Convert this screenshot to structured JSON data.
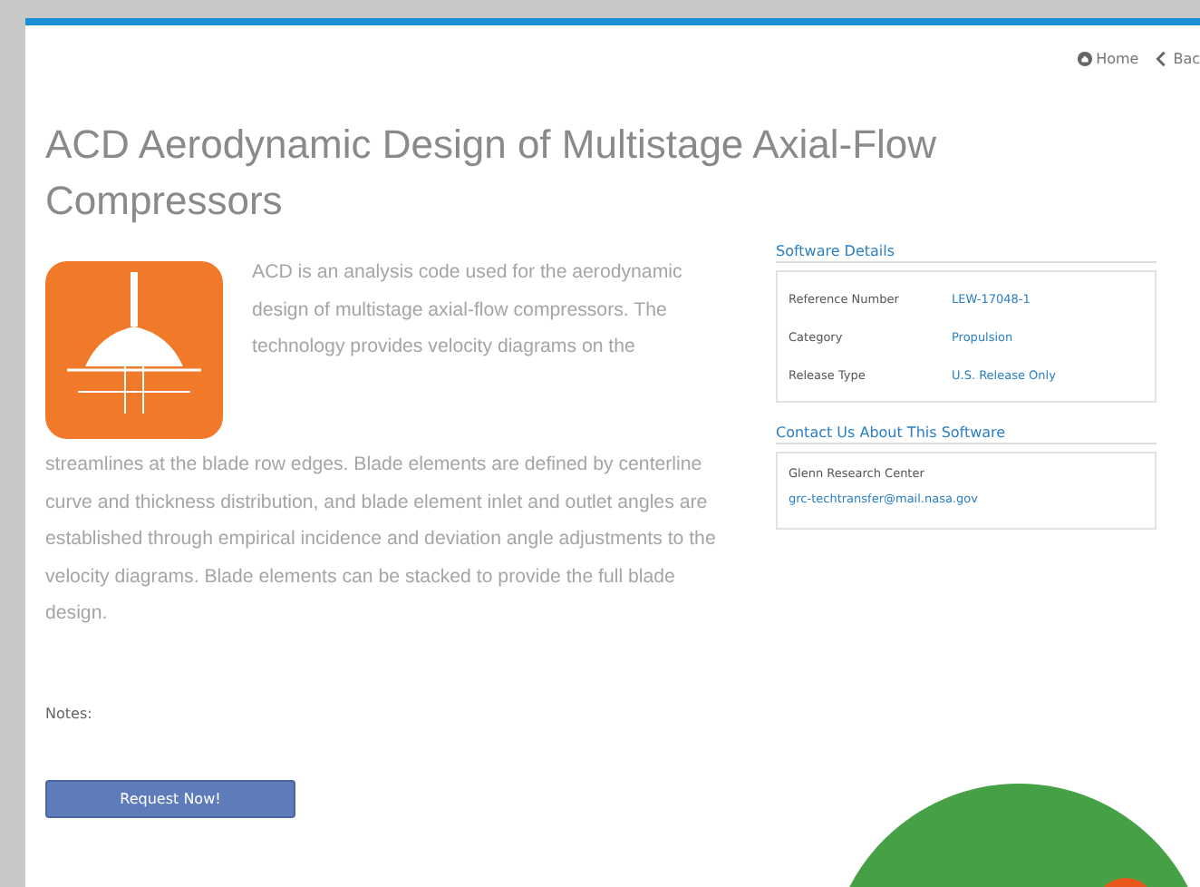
{
  "nav": [
    {
      "kind": "home",
      "label": "Home"
    },
    {
      "kind": "back",
      "label": "Bac"
    }
  ],
  "title": "ACD Aerodynamic Design of Multistage Axial-Flow Compressors",
  "description": [
    "ACD is an analysis code used for the aerodynamic design of multistage axial-flow compressors. The technology provides velocity diagrams on the",
    "streamlines at the blade row edges. Blade elements are defined by centerline curve and thickness distribution, and blade element inlet and outlet angles are established through empirical incidence and deviation angle adjustments to the velocity diagrams. Blade elements can be stacked to provide the full blade design."
  ],
  "software_details": {
    "heading": "Software Details",
    "rows": [
      {
        "label": "Reference Number",
        "value": "LEW-17048-1"
      },
      {
        "label": "Category",
        "value": "Propulsion"
      },
      {
        "label": "Release Type",
        "value": "U.S. Release Only"
      }
    ]
  },
  "contact": {
    "heading": "Contact Us About This Software",
    "center": "Glenn Research Center",
    "email": "grc-techtransfer@mail.nasa.gov"
  },
  "notes_label": "Notes:",
  "request_button": "Request Now!"
}
